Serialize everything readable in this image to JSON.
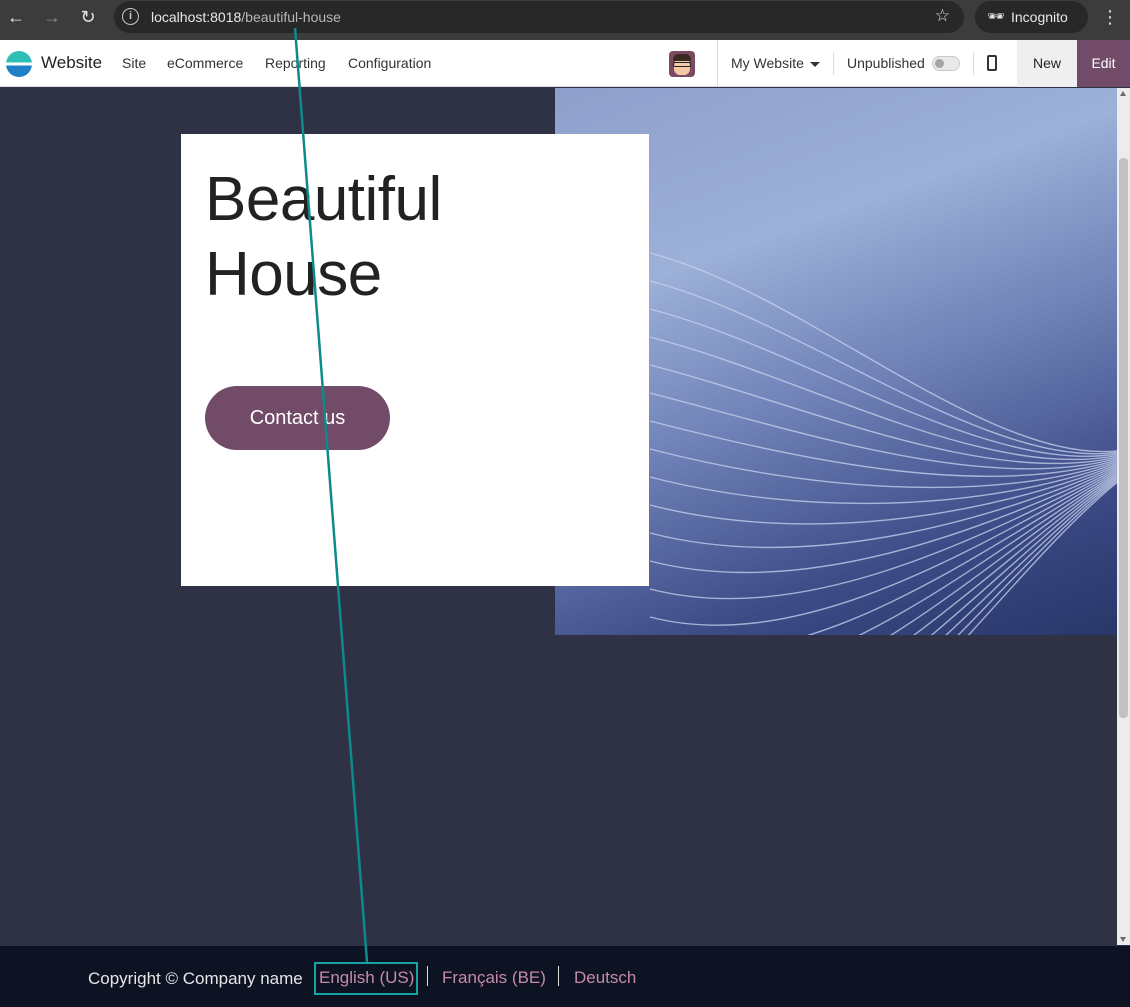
{
  "browser": {
    "url_host": "localhost:8018",
    "url_path": "/beautiful-house",
    "incognito_label": "Incognito",
    "icons": [
      "back-arrow-icon",
      "forward-arrow-icon",
      "reload-icon",
      "info-icon",
      "bookmark-star-icon",
      "incognito-icon",
      "kebab-menu-icon"
    ]
  },
  "navbar": {
    "app_name": "Website",
    "menu": [
      "Site",
      "eCommerce",
      "Reporting",
      "Configuration"
    ],
    "website_selector": "My Website",
    "publish_label": "Unpublished",
    "published": false,
    "new_label": "New",
    "edit_label": "Edit"
  },
  "page": {
    "title_line1": "Beautiful",
    "title_line2": "House",
    "cta_label": "Contact us"
  },
  "footer": {
    "copyright": "Copyright © Company name",
    "languages": [
      "English (US)",
      "Français (BE)",
      "Deutsch"
    ],
    "active_language": "English (US)"
  },
  "colors": {
    "brand": "#714b67",
    "page_background": "#2f3245",
    "footer_background": "#0e1324",
    "language_link": "#c58aa9",
    "highlight": "#16a3a3"
  }
}
